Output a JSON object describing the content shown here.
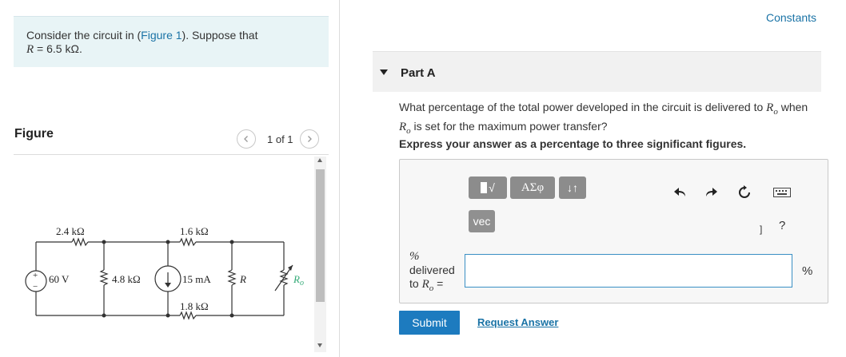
{
  "intro": {
    "prefix": "Consider the circuit in (",
    "figure_link": "Figure 1",
    "suffix": "). Suppose that",
    "r_symbol": "R",
    "r_value": " = 6.5 kΩ."
  },
  "figure": {
    "label": "Figure",
    "pager_text": "1 of 1",
    "prev_icon": "chevron-left-icon",
    "next_icon": "chevron-right-icon"
  },
  "circuit": {
    "r1": "2.4 kΩ",
    "r2": "1.6 kΩ",
    "r3": "4.8 kΩ",
    "r4": "1.8 kΩ",
    "v_source": "60 V",
    "i_source": "15 mA",
    "r_label": "R",
    "ro_label": "R",
    "ro_sub": "o",
    "plus": "+",
    "minus": "−"
  },
  "constants_link": "Constants",
  "part": {
    "title": "Part A",
    "question_prefix": "What percentage of the total power developed in the circuit is delivered to ",
    "question_sym": "R",
    "question_sub": "o",
    "question_mid": " when ",
    "question_suffix": " is set for the maximum power transfer?",
    "instruction": "Express your answer as a percentage to three significant figures."
  },
  "toolbar": {
    "template_label": "√",
    "greek_label": "ΑΣφ",
    "arrows_label": "↓↑",
    "vec_label": "vec",
    "help_label": "?",
    "bracket_label": "]"
  },
  "answer": {
    "label_line1": "%",
    "label_line2": "delivered",
    "label_line3": "to ",
    "label_sym": "R",
    "label_sub": "o",
    "label_eq": " =",
    "value": "",
    "unit": "%"
  },
  "actions": {
    "submit": "Submit",
    "request": "Request Answer"
  },
  "colors": {
    "accent": "#1d7bbf",
    "intro_bg": "#e8f4f6",
    "toolbar_btn": "#8c8c8c",
    "link": "#1a73a6"
  }
}
